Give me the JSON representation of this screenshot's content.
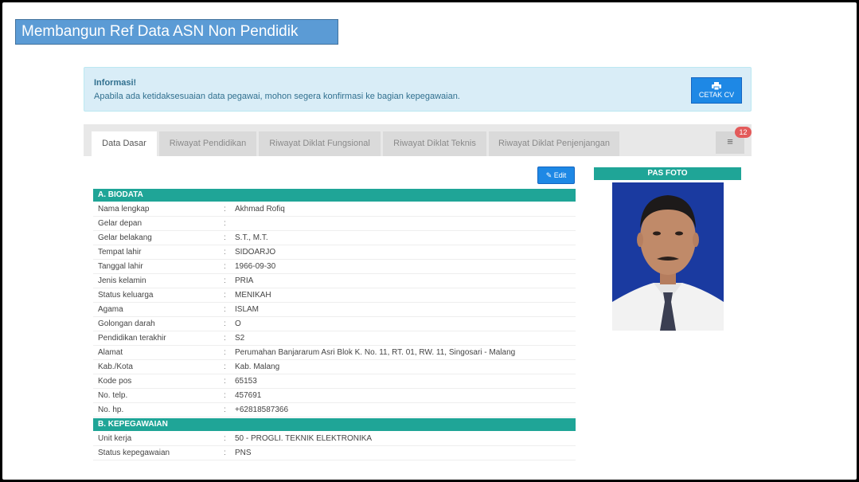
{
  "slide_title": "Membangun Ref Data ASN Non Pendidik",
  "info": {
    "title": "Informasi!",
    "text": "Apabila ada ketidaksesuaian data pegawai, mohon segera konfirmasi ke bagian kepegawaian.",
    "cetak_label": "CETAK CV"
  },
  "tabs": [
    {
      "label": "Data Dasar",
      "active": true
    },
    {
      "label": "Riwayat Pendidikan"
    },
    {
      "label": "Riwayat Diklat Fungsional"
    },
    {
      "label": "Riwayat Diklat Teknis"
    },
    {
      "label": "Riwayat Diklat Penjenjangan"
    }
  ],
  "menu_icon": "list-icon",
  "badge_count": "12",
  "edit_label": "Edit",
  "biodata": {
    "title": "A. BIODATA",
    "rows": [
      {
        "label": "Nama lengkap",
        "value": "Akhmad Rofiq"
      },
      {
        "label": "Gelar depan",
        "value": ""
      },
      {
        "label": "Gelar belakang",
        "value": "S.T., M.T."
      },
      {
        "label": "Tempat lahir",
        "value": "SIDOARJO"
      },
      {
        "label": "Tanggal lahir",
        "value": "1966-09-30"
      },
      {
        "label": "Jenis kelamin",
        "value": "PRIA"
      },
      {
        "label": "Status keluarga",
        "value": "MENIKAH"
      },
      {
        "label": "Agama",
        "value": "ISLAM"
      },
      {
        "label": "Golongan darah",
        "value": "O"
      },
      {
        "label": "Pendidikan terakhir",
        "value": "S2"
      },
      {
        "label": "Alamat",
        "value": "Perumahan Banjararum Asri Blok K. No. 11, RT. 01, RW. 11, Singosari - Malang"
      },
      {
        "label": "Kab./Kota",
        "value": "Kab. Malang"
      },
      {
        "label": "Kode pos",
        "value": "65153"
      },
      {
        "label": "No. telp.",
        "value": "457691"
      },
      {
        "label": "No. hp.",
        "value": "+62818587366"
      }
    ]
  },
  "kepegawaian": {
    "title": "B. KEPEGAWAIAN",
    "rows": [
      {
        "label": "Unit kerja",
        "value": "50 - PROGLI. TEKNIK ELEKTRONIKA"
      },
      {
        "label": "Status kepegawaian",
        "value": "PNS"
      }
    ]
  },
  "pas_foto_title": "PAS FOTO",
  "colors": {
    "accent": "#1fa597",
    "button": "#1e88e5",
    "slide_title_bg": "#5b9bd5",
    "info_bg": "#d9edf7"
  }
}
